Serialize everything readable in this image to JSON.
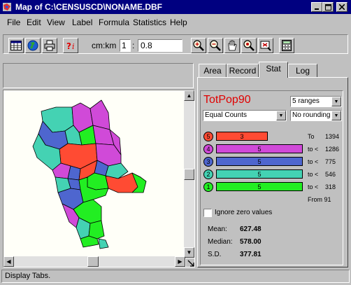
{
  "window": {
    "title": "Map of C:\\CENSUSCD\\NONAME.DBF"
  },
  "menu": {
    "items": [
      "File",
      "Edit",
      "View",
      "Label",
      "Formula",
      "Statistics",
      "Help"
    ]
  },
  "toolbar": {
    "scale_label": "cm:km",
    "scale_left": "1",
    "scale_sep": ":",
    "scale_right": "0.8",
    "icons": [
      "table-icon",
      "globe-icon",
      "printer-icon",
      "help-info-icon",
      "zoom-in-icon",
      "zoom-out-icon",
      "pan-hand-icon",
      "zoom-full-icon",
      "zoom-window-icon",
      "calculator-icon"
    ]
  },
  "tabs": [
    "Area",
    "Record",
    "Stat",
    "Log"
  ],
  "stat": {
    "variable": "TotPop90",
    "ranges_select": "5 ranges",
    "method_select": "Equal Counts",
    "rounding_select": "No rounding",
    "ranges": [
      {
        "num": "5",
        "count": "3",
        "color": "#ff4b33",
        "limit_label": "To",
        "limit_value": "1394",
        "fraction": 0.6
      },
      {
        "num": "4",
        "count": "5",
        "color": "#d04ad8",
        "limit_label": "to <",
        "limit_value": "1286",
        "fraction": 1.0
      },
      {
        "num": "3",
        "count": "5",
        "color": "#4e66cf",
        "limit_label": "to <",
        "limit_value": "775",
        "fraction": 1.0
      },
      {
        "num": "2",
        "count": "5",
        "color": "#44d2b3",
        "limit_label": "to <",
        "limit_value": "546",
        "fraction": 1.0
      },
      {
        "num": "1",
        "count": "5",
        "color": "#22ee22",
        "limit_label": "to <",
        "limit_value": "318",
        "fraction": 1.0
      }
    ],
    "from_label": "From 91",
    "ignore_zero_label": "Ignore zero values",
    "ignore_zero_checked": false,
    "mean_label": "Mean:",
    "mean_value": "627.48",
    "median_label": "Median:",
    "median_value": "578.00",
    "sd_label": "S.D.",
    "sd_value": "377.81"
  },
  "status": {
    "text": "Display Tabs."
  }
}
